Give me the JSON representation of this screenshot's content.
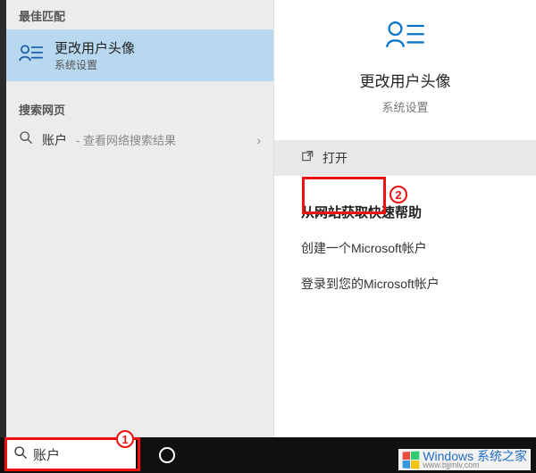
{
  "left": {
    "best_match_header": "最佳匹配",
    "best_match_title": "更改用户头像",
    "best_match_sub": "系统设置",
    "search_web_header": "搜索网页",
    "web_term": "账户",
    "web_hint": "- 查看网络搜索结果",
    "chevron": "›"
  },
  "right": {
    "title": "更改用户头像",
    "sub": "系统设置",
    "open_label": "打开",
    "help_header": "从网站获取快速帮助",
    "help_items": [
      "创建一个Microsoft帐户",
      "登录到您的Microsoft帐户"
    ]
  },
  "search": {
    "value": "账户"
  },
  "annotations": {
    "n1": "1",
    "n2": "2"
  },
  "watermark": {
    "brand": "Windows",
    "suffix": "系统之家",
    "url": "www.bjjmlv.com"
  }
}
